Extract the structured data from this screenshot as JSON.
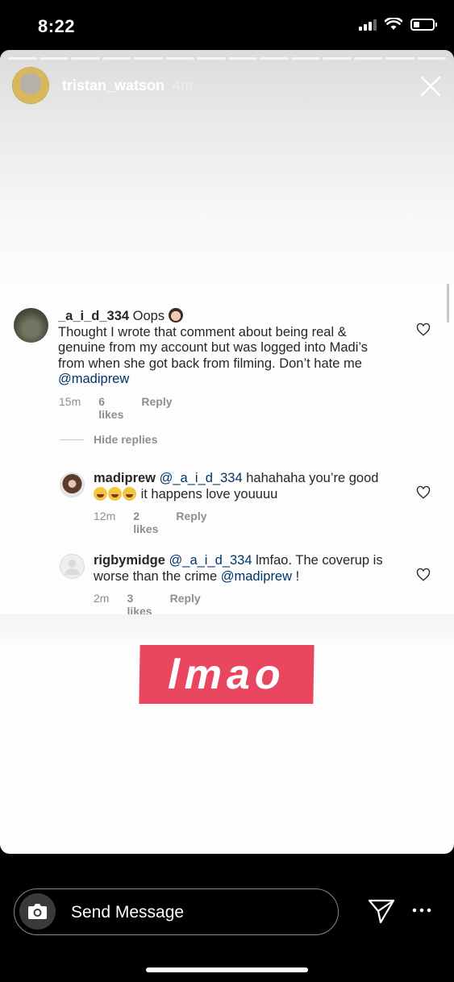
{
  "status_bar": {
    "time": "8:22"
  },
  "story": {
    "username": "tristan_watson",
    "age": "4m",
    "progress_segments": 14
  },
  "comments": {
    "main": {
      "username": "_a_i_d_334",
      "lead": "Oops",
      "line1": "Thought I wrote that comment about being real &",
      "line2": "genuine from my account but was logged into Madi’s",
      "line3": "from when she got back from filming. Don’t hate me",
      "mention": "@madiprew",
      "time": "15m",
      "likes": "6 likes",
      "reply": "Reply"
    },
    "hide_replies": "Hide replies",
    "reply1": {
      "username": "madiprew",
      "mention": "@_a_i_d_334",
      "text1": "hahahaha you’re good",
      "text2": "it happens love youuuu",
      "time": "12m",
      "likes": "2 likes",
      "reply": "Reply"
    },
    "reply2": {
      "username": "rigbymidge",
      "mention": "@_a_i_d_334",
      "text1": "lmfao. The coverup is",
      "text2": "worse than the crime",
      "mention2": "@madiprew",
      "end": "!",
      "time": "2m",
      "likes": "3 likes",
      "reply": "Reply"
    }
  },
  "sticker": {
    "text": "lmao",
    "color": "#e8475f"
  },
  "bottom_bar": {
    "send_placeholder": "Send Message"
  },
  "colors": {
    "mention": "#003569",
    "meta": "#8e8e8e",
    "text": "#262626"
  }
}
